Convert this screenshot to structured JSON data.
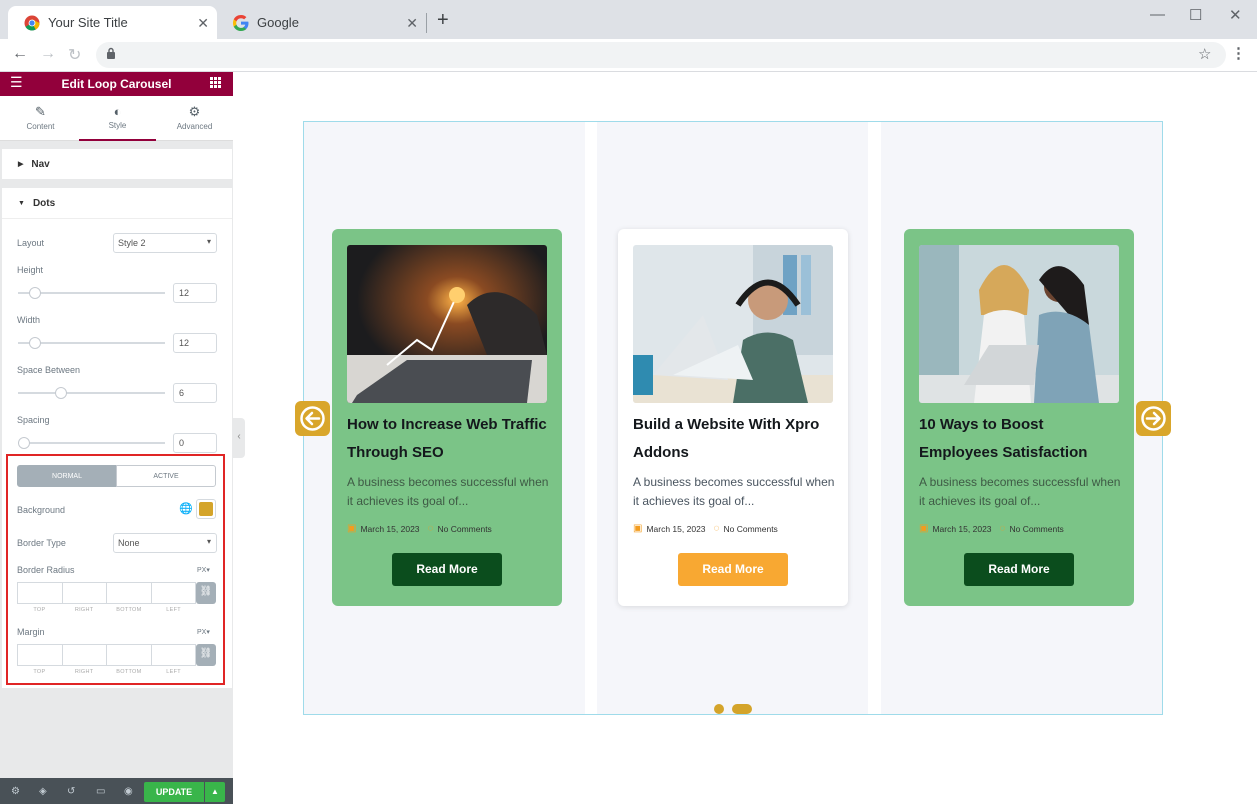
{
  "browser": {
    "tabs": [
      {
        "title": "Your Site Title"
      },
      {
        "title": "Google"
      }
    ],
    "new_tab": "+",
    "window": {
      "minimize": "—",
      "maximize": "☐",
      "close": "✕"
    }
  },
  "editor": {
    "title": "Edit Loop Carousel",
    "tabs": [
      {
        "label": "Content",
        "icon": "✎"
      },
      {
        "label": "Style",
        "icon": "◐"
      },
      {
        "label": "Advanced",
        "icon": "⚙"
      }
    ],
    "sections": {
      "nav": "Nav",
      "dots": "Dots"
    },
    "layout": {
      "label": "Layout",
      "value": "Style 2"
    },
    "height": {
      "label": "Height",
      "value": "12",
      "level": 0.12
    },
    "width": {
      "label": "Width",
      "value": "12",
      "level": 0.12
    },
    "space_between": {
      "label": "Space Between",
      "value": "6",
      "level": 0.3
    },
    "spacing": {
      "label": "Spacing",
      "value": "0",
      "level": 0
    },
    "state_tabs": {
      "normal": "NORMAL",
      "active": "ACTIVE"
    },
    "background": {
      "label": "Background",
      "color": "#d4a42a"
    },
    "border_type": {
      "label": "Border Type",
      "value": "None"
    },
    "border_radius": {
      "label": "Border Radius",
      "unit": "PX"
    },
    "margin": {
      "label": "Margin",
      "unit": "PX"
    },
    "dim_labels": [
      "TOP",
      "RIGHT",
      "BOTTOM",
      "LEFT"
    ],
    "update": "UPDATE"
  },
  "carousel": {
    "cards": [
      {
        "title": "How to Increase Web Traffic Through SEO",
        "excerpt": "A business becomes successful when it achieves its goal of...",
        "date": "March 15, 2023",
        "comments": "No Comments",
        "button": "Read More",
        "style": "green"
      },
      {
        "title": "Build a Website With Xpro Addons",
        "excerpt": "A business becomes successful when it achieves its goal of...",
        "date": "March 15, 2023",
        "comments": "No Comments",
        "button": "Read More",
        "style": "white"
      },
      {
        "title": "10 Ways to Boost Employees Satisfaction",
        "excerpt": "A business becomes successful when it achieves its goal of...",
        "date": "March 15, 2023",
        "comments": "No Comments",
        "button": "Read More",
        "style": "green"
      }
    ],
    "accent": "#d9a62b",
    "card_green": "#7bc487",
    "button_dark": "#0b4d1d",
    "button_orange": "#f8a832"
  }
}
